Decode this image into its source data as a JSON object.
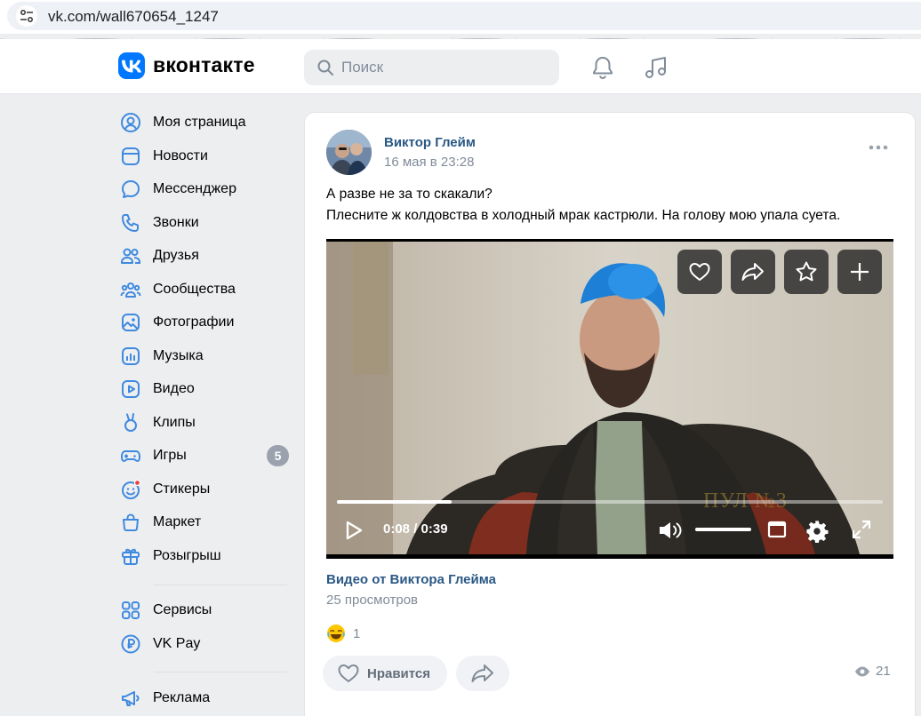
{
  "browser": {
    "url": "vk.com/wall670654_1247"
  },
  "header": {
    "logo_text": "вконтакте",
    "search_placeholder": "Поиск"
  },
  "sidebar": {
    "items": [
      {
        "label": "Моя страница",
        "icon": "profile-icon"
      },
      {
        "label": "Новости",
        "icon": "news-icon"
      },
      {
        "label": "Мессенджер",
        "icon": "messenger-icon"
      },
      {
        "label": "Звонки",
        "icon": "phone-icon"
      },
      {
        "label": "Друзья",
        "icon": "friends-icon"
      },
      {
        "label": "Сообщества",
        "icon": "communities-icon"
      },
      {
        "label": "Фотографии",
        "icon": "photos-icon"
      },
      {
        "label": "Музыка",
        "icon": "music-icon"
      },
      {
        "label": "Видео",
        "icon": "video-icon"
      },
      {
        "label": "Клипы",
        "icon": "clips-icon"
      },
      {
        "label": "Игры",
        "icon": "games-icon",
        "badge": "5"
      },
      {
        "label": "Стикеры",
        "icon": "stickers-icon"
      },
      {
        "label": "Маркет",
        "icon": "market-icon"
      },
      {
        "label": "Розыгрыш",
        "icon": "gift-icon"
      },
      {
        "label": "Сервисы",
        "icon": "services-icon"
      },
      {
        "label": "VK Pay",
        "icon": "vkpay-icon"
      },
      {
        "label": "Реклама",
        "icon": "ads-icon"
      }
    ]
  },
  "post": {
    "author": "Виктор Глейм",
    "date": "16 мая в 23:28",
    "text_line1": "А разве не за то скакали?",
    "text_line2": "Плесните ж колдовства в холодный мрак кастрюли. На голову мою упала суета.",
    "video": {
      "time": "0:08 / 0:39",
      "progress": 0.21,
      "volume": 1.0,
      "watermark": "ПУЛ №3"
    },
    "video_title": "Видео от Виктора Глейма",
    "video_views": "25 просмотров",
    "reaction_count": "1",
    "like_label": "Нравится",
    "views": "21"
  },
  "colors": {
    "accent": "#0077ff",
    "link": "#2a5885",
    "muted": "#818c99",
    "icon": "#3f8ae0"
  }
}
